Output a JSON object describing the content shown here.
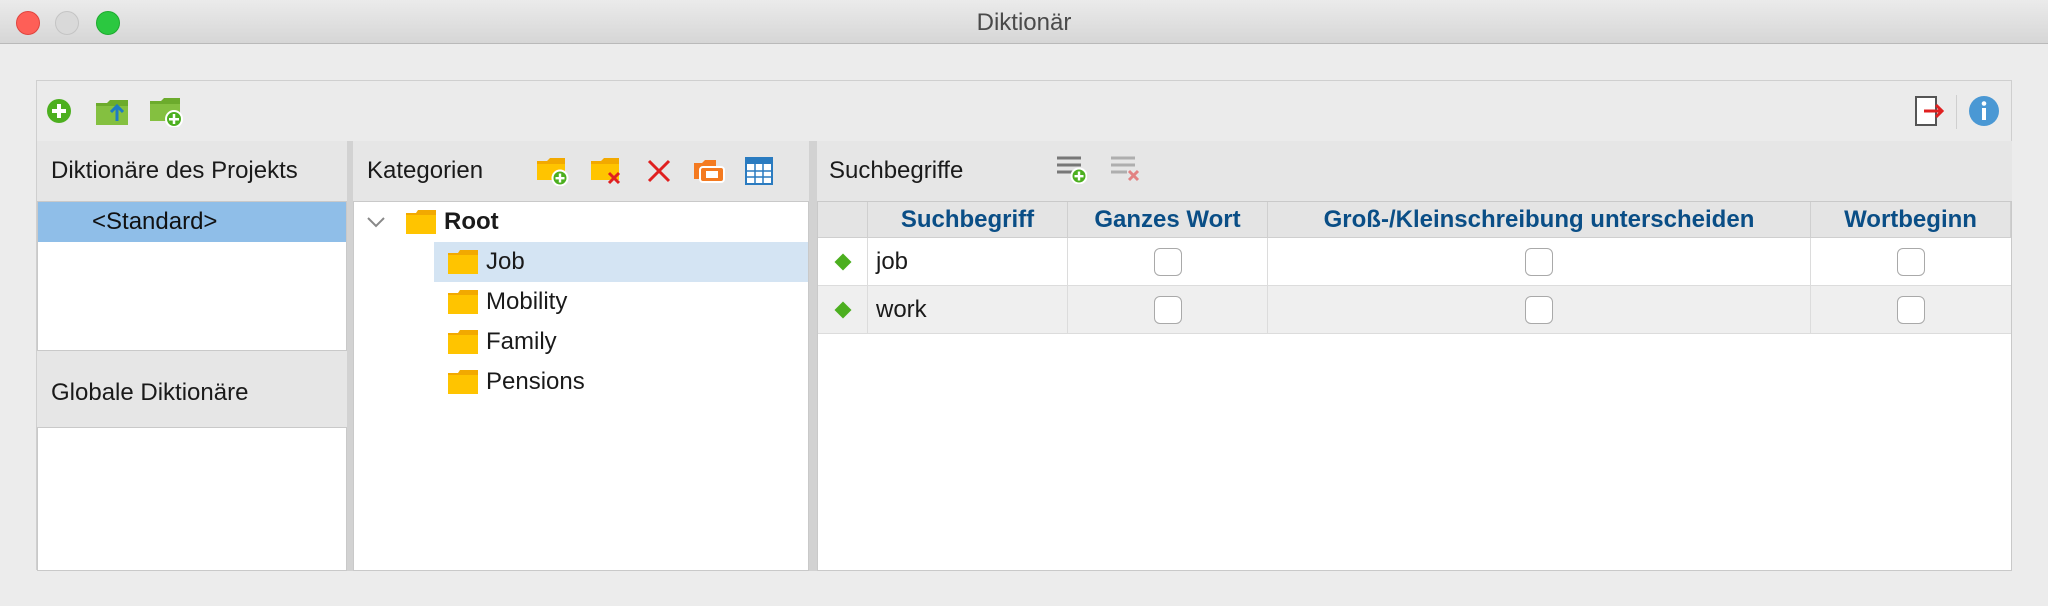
{
  "window": {
    "title": "Diktionär"
  },
  "toolbar": {
    "left_icons": [
      "add-icon",
      "import-dictionary-icon",
      "new-dictionary-icon"
    ],
    "right_icons": [
      "export-icon",
      "info-icon"
    ]
  },
  "left_panel": {
    "project_header": "Diktionäre des Projekts",
    "project_items": [
      "<Standard>"
    ],
    "global_header": "Globale Diktionäre",
    "global_items": []
  },
  "categories": {
    "header": "Kategorien",
    "tools": [
      "new-category-icon",
      "delete-category-icon",
      "remove-icon",
      "rename-icon",
      "table-view-icon"
    ],
    "root": "Root",
    "items": [
      "Job",
      "Mobility",
      "Family",
      "Pensions"
    ],
    "selected": "Job"
  },
  "search_terms": {
    "header": "Suchbegriffe",
    "tools": [
      "add-search-term-icon",
      "delete-search-term-icon"
    ],
    "columns": [
      "Suchbegriff",
      "Ganzes Wort",
      "Groß-/Kleinschreibung unterscheiden",
      "Wortbeginn"
    ],
    "rows": [
      {
        "term": "job",
        "whole_word": false,
        "case_sensitive": false,
        "word_start": false
      },
      {
        "term": "work",
        "whole_word": false,
        "case_sensitive": false,
        "word_start": false
      }
    ]
  },
  "colors": {
    "selection": "#8fbee8",
    "tree_selection": "#d4e4f3",
    "header_text": "#0a4e86",
    "accent_green": "#4caf1f",
    "folder_yellow": "#ffc400"
  }
}
